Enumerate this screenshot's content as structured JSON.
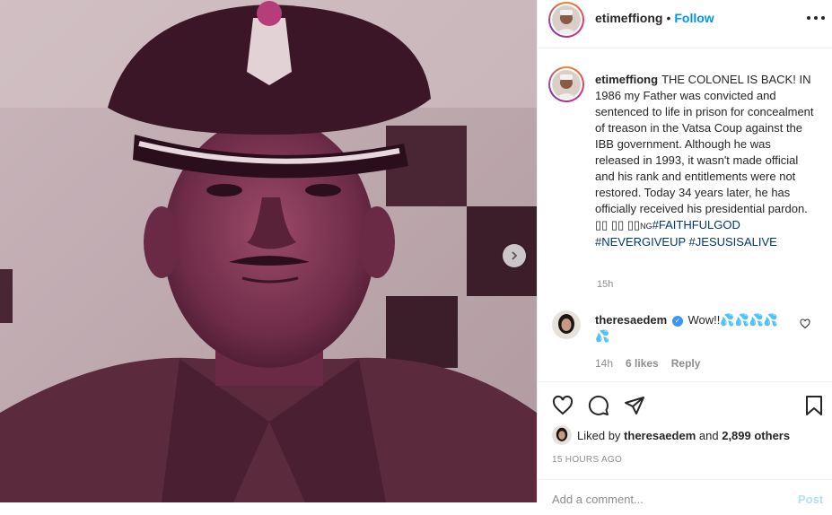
{
  "post": {
    "author": "etimeffiong",
    "follow_label": "Follow",
    "dot": "•",
    "caption_text": "THE COLONEL IS BACK! IN 1986 my Father was convicted and sentenced to life in prison for concealment of treason in the Vatsa Coup against the IBB government. Although he was released in 1993, it wasn't made official and his rank and entitlements were not restored. Today 34 years later, he has officially received his presidential pardon. ▯▯ ▯▯ ▯▯",
    "caption_ng": "NG",
    "hashtags": [
      "#FAITHFULGOD",
      "#NEVERGIVEUP",
      "#JESUSISALIVE"
    ],
    "caption_time": "15h"
  },
  "comment": {
    "user": "theresaedem",
    "text": "Wow!!💦💦💦💦💦",
    "time": "14h",
    "likes": "6 likes",
    "reply": "Reply"
  },
  "likes_line": {
    "prefix": "Liked by",
    "user": "theresaedem",
    "and": "and",
    "others": "2,899 others"
  },
  "posted_time": "15 HOURS AGO",
  "add_comment": {
    "placeholder": "Add a comment...",
    "post_label": "Post"
  },
  "icons": {
    "more": "more-options-icon",
    "next": "chevron-right-icon",
    "heart": "heart-icon",
    "comment": "comment-icon",
    "share": "paper-plane-icon",
    "save": "bookmark-icon",
    "verified": "verified-badge-icon"
  },
  "colors": {
    "link_blue": "#0095f6",
    "hashtag": "#00376b",
    "muted": "#8e8e8e",
    "text": "#262626"
  }
}
